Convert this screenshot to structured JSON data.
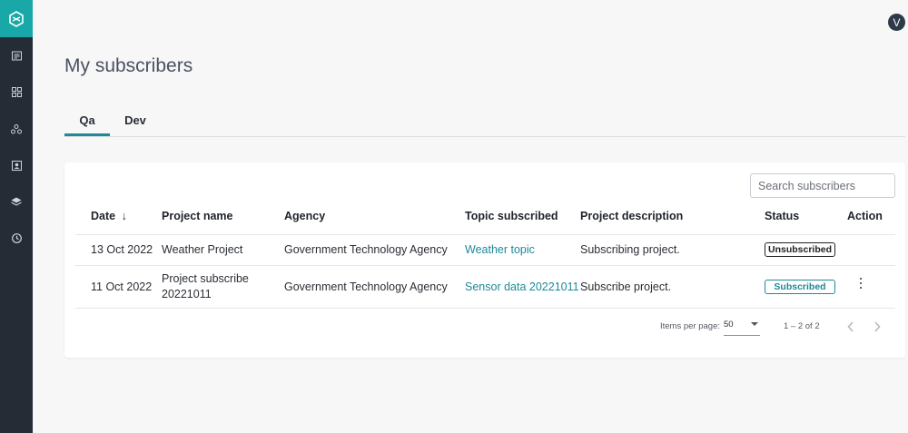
{
  "user": {
    "avatar_initial": "V"
  },
  "page": {
    "title": "My subscribers"
  },
  "tabs": [
    {
      "label": "Qa"
    },
    {
      "label": "Dev"
    }
  ],
  "search": {
    "placeholder": "Search subscribers"
  },
  "table": {
    "headers": {
      "date": "Date",
      "sort_icon": "↓",
      "project_name": "Project name",
      "agency": "Agency",
      "topic": "Topic subscribed",
      "description": "Project description",
      "status": "Status",
      "action": "Action"
    },
    "rows": [
      {
        "date": "13 Oct 2022",
        "project_name_line1": "Weather Project",
        "project_name_line2": "",
        "agency": "Government Technology Agency",
        "topic": "Weather topic",
        "description": "Subscribing project.",
        "status": "Unsubscribed"
      },
      {
        "date": "11 Oct 2022",
        "project_name_line1": "Project subscribe",
        "project_name_line2": "20221011",
        "agency": "Government Technology Agency",
        "topic": "Sensor data 20221011",
        "description": "Subscribe project.",
        "status": "Subscribed"
      }
    ]
  },
  "pagination": {
    "items_per_page_label": "Items per page:",
    "items_per_page": "50",
    "range": "1 – 2 of 2"
  },
  "colors": {
    "accent": "#1d8a96",
    "sidebar": "#262c36",
    "logo_bg": "#19a8a8"
  },
  "icons": {
    "sidebar": [
      "logo-icon",
      "catalog-icon",
      "apps-icon",
      "nodes-icon",
      "contacts-icon",
      "layers-icon",
      "clock-icon"
    ]
  }
}
